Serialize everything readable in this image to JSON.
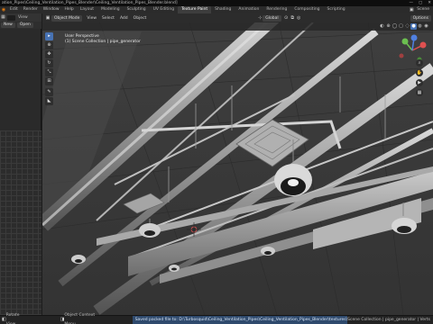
{
  "titlebar": {
    "title": "ation_Pipes\\Ceiling_Ventilation_Pipes_Blender\\Ceiling_Ventilation_Pipes_Blender.blend]",
    "minimize": "—",
    "maximize": "▢",
    "close": "✕"
  },
  "menus": [
    "Edit",
    "Render",
    "Window",
    "Help"
  ],
  "workspaces": [
    "Layout",
    "Modeling",
    "Sculpting",
    "UV Editing",
    "Texture Paint",
    "Shading",
    "Animation",
    "Rendering",
    "Compositing",
    "Scripting"
  ],
  "active_workspace": "Texture Paint",
  "scene_label": "Scene",
  "left_panel": {
    "new_button": "New",
    "open_button": "Open",
    "view_label": "View"
  },
  "viewport_header": {
    "mode": "Object Mode",
    "menus": [
      "View",
      "Select",
      "Add",
      "Object"
    ],
    "transform_orientation": "Global",
    "options": "Options"
  },
  "viewport_overlay": {
    "perspective": "User Perspective",
    "collection": "(1) Scene Collection | pipe_generator"
  },
  "statusbar": {
    "left": "Rotate View",
    "middle": "Object Context Menu",
    "info": "Saved packed file to: D:\\Turbosquid\\Ceiling_Ventilation_Pipes\\Ceiling_Ventilation_Pipes_Blender\\textures\\ceiling_ceiling_ao_baked_vent.png",
    "right": "Scene Collection | pipe_generator | Verts"
  }
}
